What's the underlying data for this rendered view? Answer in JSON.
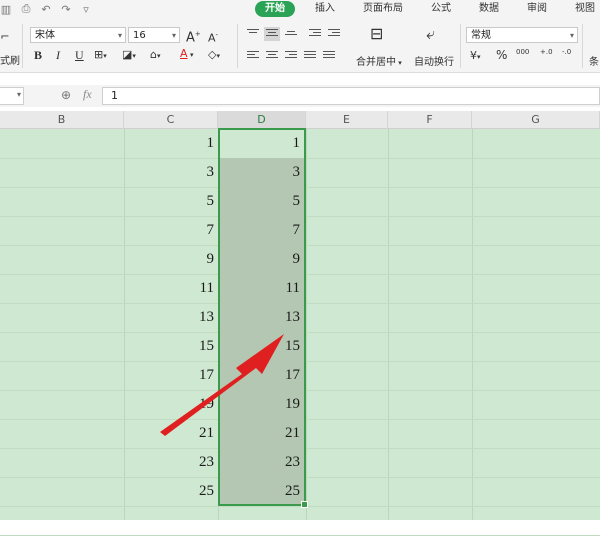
{
  "quick_access": [
    "spreadsheet-icon",
    "print-preview-icon",
    "undo-icon",
    "redo-icon",
    "customize-icon"
  ],
  "menu": {
    "tabs": [
      "开始",
      "插入",
      "页面布局",
      "公式",
      "数据",
      "审阅",
      "视图"
    ],
    "active": "开始"
  },
  "ribbon": {
    "format_painter_fragment": "式刷",
    "font_name": "宋体",
    "font_size": "16",
    "merge_label": "合并居中",
    "wrap_label": "自动换行",
    "number_format": "常规",
    "cond_fragment": "条",
    "font_grow": "A",
    "font_shrink": "A",
    "bold": "B",
    "italic": "I",
    "underline": "U",
    "font_color_letter": "A",
    "percent": "%",
    "thousands": "000",
    "decimal_increase": "+.0",
    "decimal_decrease": "-.0",
    "currency": "¥"
  },
  "formula_bar": {
    "fx": "fx",
    "content": "1"
  },
  "columns": [
    "B",
    "C",
    "D",
    "E",
    "F",
    "G"
  ],
  "selected_column": "D",
  "column_c": [
    "1",
    "3",
    "5",
    "7",
    "9",
    "11",
    "13",
    "15",
    "17",
    "19",
    "21",
    "23",
    "25"
  ],
  "column_d": [
    "1",
    "3",
    "5",
    "7",
    "9",
    "11",
    "13",
    "15",
    "17",
    "19",
    "21",
    "23",
    "25"
  ],
  "colors": {
    "accent_green": "#2aa356",
    "sheet_background": "#cfe8d1",
    "selection_border": "#3b9a4c",
    "selection_fill": "#b3c7b2",
    "arrow_red": "#e02020"
  }
}
